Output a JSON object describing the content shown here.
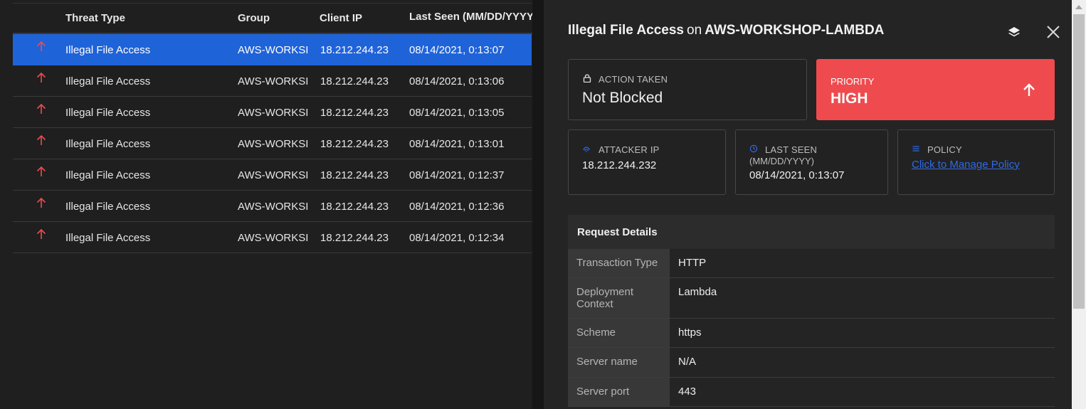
{
  "table": {
    "headers": {
      "threat_type": "Threat Type",
      "group": "Group",
      "client_ip": "Client IP",
      "last_seen": "Last Seen (MM/DD/YYYY)"
    },
    "rows": [
      {
        "threat_type": "Illegal File Access",
        "group": "AWS-WORKSI",
        "client_ip": "18.212.244.23",
        "last_seen": "08/14/2021, 0:13:07"
      },
      {
        "threat_type": "Illegal File Access",
        "group": "AWS-WORKSI",
        "client_ip": "18.212.244.23",
        "last_seen": "08/14/2021, 0:13:06"
      },
      {
        "threat_type": "Illegal File Access",
        "group": "AWS-WORKSI",
        "client_ip": "18.212.244.23",
        "last_seen": "08/14/2021, 0:13:05"
      },
      {
        "threat_type": "Illegal File Access",
        "group": "AWS-WORKSI",
        "client_ip": "18.212.244.23",
        "last_seen": "08/14/2021, 0:13:01"
      },
      {
        "threat_type": "Illegal File Access",
        "group": "AWS-WORKSI",
        "client_ip": "18.212.244.23",
        "last_seen": "08/14/2021, 0:12:37"
      },
      {
        "threat_type": "Illegal File Access",
        "group": "AWS-WORKSI",
        "client_ip": "18.212.244.23",
        "last_seen": "08/14/2021, 0:12:36"
      },
      {
        "threat_type": "Illegal File Access",
        "group": "AWS-WORKSI",
        "client_ip": "18.212.244.23",
        "last_seen": "08/14/2021, 0:12:34"
      }
    ],
    "row_icon": "arrow-up-icon",
    "row_icon_color": "#ef4b4f",
    "selected_row_color": "#1f63d9"
  },
  "panel": {
    "title_threat": "Illegal File Access",
    "title_on": "on",
    "title_target": "AWS-WORKSHOP-LAMBDA",
    "action_label": "ACTION TAKEN",
    "action_value": "Not Blocked",
    "priority_label": "PRIORITY",
    "priority_value": "HIGH",
    "priority_color": "#ef4b4f",
    "attacker_ip_label": "ATTACKER IP",
    "attacker_ip_value": "18.212.244.232",
    "last_seen_label": "LAST SEEN",
    "last_seen_sub": "(MM/DD/YYYY)",
    "last_seen_value": "08/14/2021, 0:13:07",
    "policy_label": "POLICY",
    "policy_link": "Click to Manage Policy",
    "request_details": {
      "heading": "Request Details",
      "rows": [
        {
          "key": "Transaction Type",
          "value": "HTTP"
        },
        {
          "key": "Deployment Context",
          "value": "Lambda"
        },
        {
          "key": "Scheme",
          "value": "https"
        },
        {
          "key": "Server name",
          "value": "N/A"
        },
        {
          "key": "Server port",
          "value": "443"
        }
      ]
    },
    "icons": [
      "layers-icon",
      "close-icon",
      "lock-icon",
      "fingerprint-icon",
      "clock-icon",
      "list-icon"
    ]
  }
}
